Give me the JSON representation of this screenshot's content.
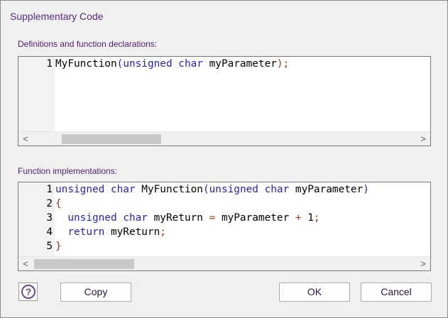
{
  "window": {
    "title": "Supplementary Code"
  },
  "definitions": {
    "label": "Definitions and function declarations:",
    "lines": [
      {
        "num": "1",
        "segments": [
          {
            "t": "MyFunction",
            "c": "plain"
          },
          {
            "t": "(",
            "c": "kw"
          },
          {
            "t": "unsigned",
            "c": "kw"
          },
          {
            "t": " ",
            "c": "plain"
          },
          {
            "t": "char",
            "c": "kw"
          },
          {
            "t": " myParameter",
            "c": "plain"
          },
          {
            "t": ");",
            "c": "punc"
          }
        ]
      }
    ]
  },
  "implementations": {
    "label": "Function implementations:",
    "lines": [
      {
        "num": "1",
        "segments": [
          {
            "t": "unsigned",
            "c": "kw"
          },
          {
            "t": " ",
            "c": "plain"
          },
          {
            "t": "char",
            "c": "kw"
          },
          {
            "t": " MyFunction",
            "c": "plain"
          },
          {
            "t": "(",
            "c": "kw"
          },
          {
            "t": "unsigned",
            "c": "kw"
          },
          {
            "t": " ",
            "c": "plain"
          },
          {
            "t": "char",
            "c": "kw"
          },
          {
            "t": " myParameter",
            "c": "plain"
          },
          {
            "t": ")",
            "c": "kw"
          }
        ]
      },
      {
        "num": "2",
        "segments": [
          {
            "t": "{",
            "c": "punc"
          }
        ]
      },
      {
        "num": "3",
        "segments": [
          {
            "t": "  ",
            "c": "plain"
          },
          {
            "t": "unsigned",
            "c": "kw"
          },
          {
            "t": " ",
            "c": "plain"
          },
          {
            "t": "char",
            "c": "kw"
          },
          {
            "t": " myReturn ",
            "c": "plain"
          },
          {
            "t": "=",
            "c": "punc"
          },
          {
            "t": " myParameter ",
            "c": "plain"
          },
          {
            "t": "+",
            "c": "punc"
          },
          {
            "t": " 1",
            "c": "plain"
          },
          {
            "t": ";",
            "c": "punc"
          }
        ]
      },
      {
        "num": "4",
        "segments": [
          {
            "t": "  ",
            "c": "plain"
          },
          {
            "t": "return",
            "c": "kw"
          },
          {
            "t": " myReturn",
            "c": "plain"
          },
          {
            "t": ";",
            "c": "punc"
          }
        ]
      },
      {
        "num": "5",
        "segments": [
          {
            "t": "}",
            "c": "punc"
          }
        ]
      }
    ]
  },
  "buttons": {
    "copy": "Copy",
    "ok": "OK",
    "cancel": "Cancel"
  },
  "help": {
    "glyph": "?"
  },
  "scrollbar": {
    "left_arrow": "<",
    "right_arrow": ">"
  },
  "colors": {
    "keyword": "#1f1fd8",
    "punctuation": "#a23c1a",
    "label": "#4b1f70"
  }
}
